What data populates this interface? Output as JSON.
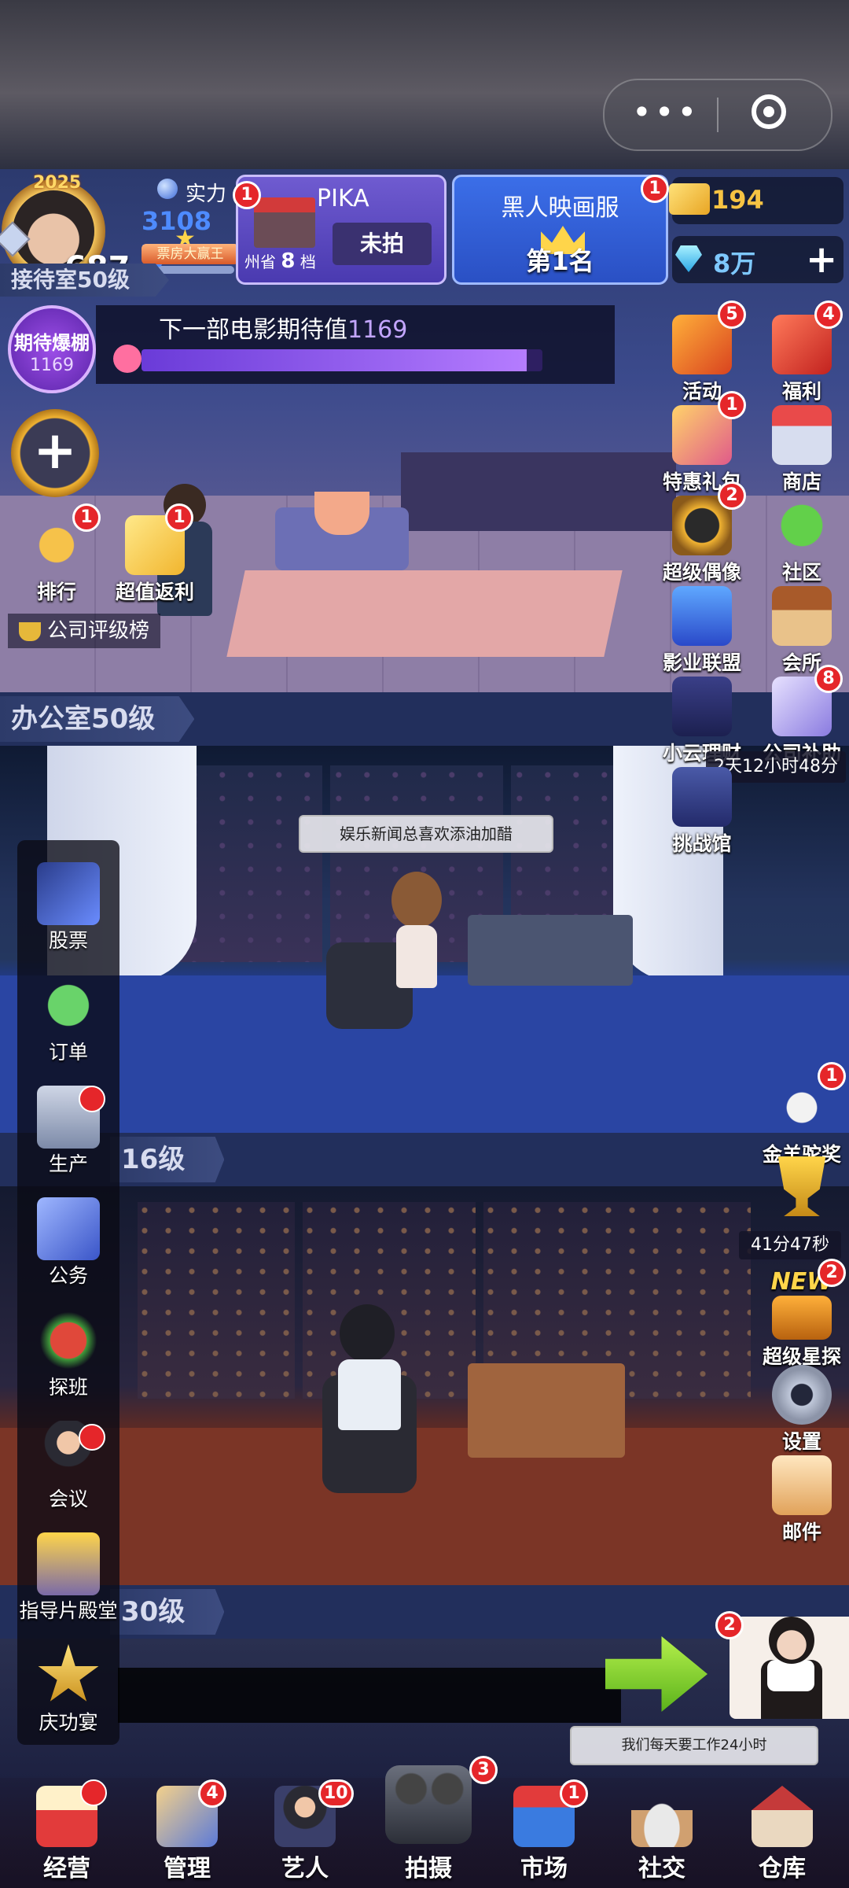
{
  "hud": {
    "year": "2025",
    "level": "687",
    "power_label": "实力",
    "power_value": "3108万",
    "power_title": "票房大赢王",
    "power_badge": "1",
    "company_card": {
      "name": "PIKA",
      "sub_prefix": "州省",
      "sub_number": "8",
      "sub_suffix": "档",
      "status_button": "未拍"
    },
    "rank_card": {
      "title": "黑人映画服",
      "rank": "第1名",
      "badge": "1"
    },
    "gold_value": "194",
    "gem_value": "8万",
    "gem_plus": "+"
  },
  "capsule": {
    "more": "•••"
  },
  "expectation": {
    "circle_label": "期待爆棚",
    "circle_value": "1169",
    "text": "下一部电影期待值",
    "value": "1169",
    "progress": 0.96
  },
  "left_quick": {
    "plus": "+",
    "rank": {
      "label": "排行",
      "badge": "1"
    },
    "rebate": {
      "label": "超值返利",
      "badge": "1"
    },
    "company_rating": "公司评级榜"
  },
  "right_icons": [
    {
      "label": "活动",
      "badge": "5"
    },
    {
      "label": "福利",
      "badge": "4"
    },
    {
      "label": "特惠礼包",
      "badge": "1"
    },
    {
      "label": "商店",
      "badge": ""
    },
    {
      "label": "超级偶像",
      "badge": "2"
    },
    {
      "label": "社区",
      "badge": ""
    },
    {
      "label": "影业联盟",
      "badge": ""
    },
    {
      "label": "会所",
      "badge": ""
    },
    {
      "label": "小云理财",
      "badge": ""
    },
    {
      "label": "公司补助",
      "badge": "8"
    },
    {
      "label": "挑战馆",
      "badge": ""
    },
    {
      "label": "金羊驼奖",
      "badge": "1"
    },
    {
      "label": "超级星探",
      "badge": "2"
    },
    {
      "label": "设置",
      "badge": ""
    },
    {
      "label": "邮件",
      "badge": ""
    }
  ],
  "timers": {
    "subsidy": "2天12小时48分",
    "trophy": "41分47秒"
  },
  "new_tag": "NEW",
  "floors": {
    "reception": "接待室50级",
    "office": "办公室50级",
    "office2": "16级",
    "office3": "30级"
  },
  "bubbles": {
    "news": "娱乐新闻总喜欢添油加醋",
    "work": "我们每天要工作24小时"
  },
  "hostess_badge": "2",
  "sidebar": [
    {
      "label": "股票"
    },
    {
      "label": "订单"
    },
    {
      "label": "生产"
    },
    {
      "label": "公务"
    },
    {
      "label": "探班"
    },
    {
      "label": "会议"
    },
    {
      "label": "指导片殿堂"
    },
    {
      "label": "庆功宴"
    }
  ],
  "bottom_nav": [
    {
      "label": "经营",
      "badge": ""
    },
    {
      "label": "管理",
      "badge": "4"
    },
    {
      "label": "艺人",
      "badge": "10"
    },
    {
      "label": "拍摄",
      "badge": "3"
    },
    {
      "label": "市场",
      "badge": "1"
    },
    {
      "label": "社交",
      "badge": ""
    },
    {
      "label": "仓库",
      "badge": ""
    }
  ]
}
